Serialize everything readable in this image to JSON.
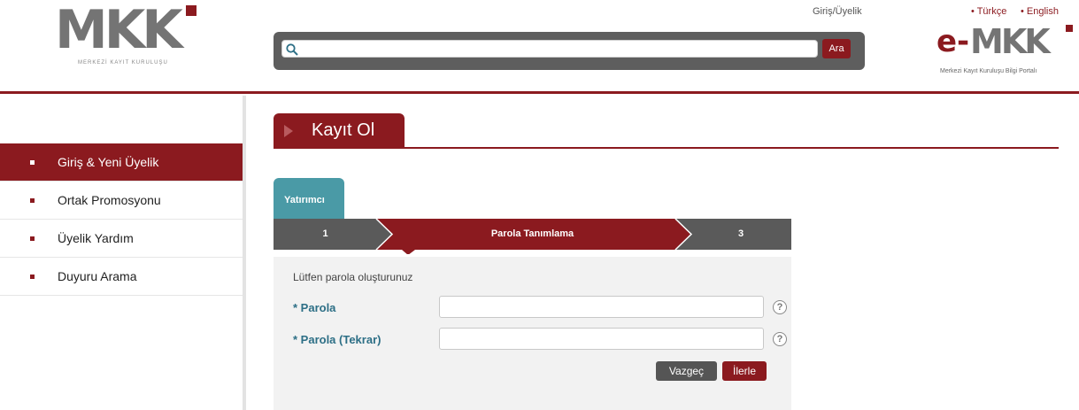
{
  "header": {
    "logo_text": "MKK",
    "logo_subtitle": "MERKEZİ KAYIT KURULUŞU",
    "login_link": "Giriş/Üyelik",
    "lang_tr": "• Türkçe",
    "lang_en": "• English",
    "search": {
      "placeholder": "",
      "button": "Ara"
    },
    "emkk_logo_e": "e-",
    "emkk_logo_text": "MKK",
    "emkk_subtitle": "Merkezi Kayıt Kuruluşu Bilgi Portalı"
  },
  "sidebar": {
    "items": [
      {
        "label": "Giriş & Yeni Üyelik",
        "active": true
      },
      {
        "label": "Ortak Promosyonu",
        "active": false
      },
      {
        "label": "Üyelik Yardım",
        "active": false
      },
      {
        "label": "Duyuru Arama",
        "active": false
      }
    ]
  },
  "page": {
    "title": "Kayıt Ol",
    "tab": "Yatırımcı",
    "steps": [
      "1",
      "Parola Tanımlama",
      "3"
    ],
    "active_step": 2,
    "form": {
      "intro": "Lütfen parola oluşturunuz",
      "fields": [
        {
          "label": "* Parola",
          "value": ""
        },
        {
          "label": "* Parola (Tekrar)",
          "value": ""
        }
      ],
      "help_glyph": "?",
      "cancel": "Vazgeç",
      "next": "İlerle"
    }
  },
  "colors": {
    "brand": "#8b1a1f",
    "teal": "#4a9aa6",
    "dark": "#5e5e5e"
  }
}
